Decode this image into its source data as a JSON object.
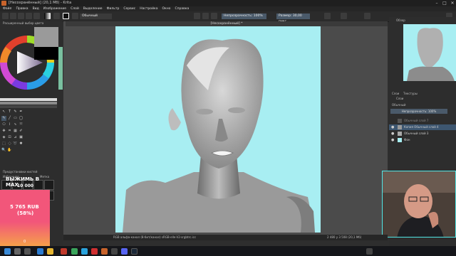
{
  "window": {
    "title": "[Несохранённый]  (20,1 Мб)  - Krita",
    "minimize": "–",
    "maximize": "□",
    "close": "✕"
  },
  "menu": [
    "Файл",
    "Правка",
    "Вид",
    "Изображение",
    "Слой",
    "Выделение",
    "Фильтр",
    "Сервис",
    "Настройка",
    "Окно",
    "Справка"
  ],
  "toolbar": {
    "blend_mode": "Обычный",
    "opacity": "Непрозрачность: 100%",
    "size": "Размер: 30,00 пикс."
  },
  "left_panel": {
    "color_title": "Расширенный выбор цвета",
    "brushes_title": "Предустановки кистей",
    "tags_label": "Избранное",
    "tag_label": "Метка"
  },
  "stream_overlay": {
    "title_line": "ВЫЖИМЬ В МАХ",
    "goal": "10 000",
    "amount": "5 765 RUB",
    "percent": "(58%)",
    "counter": "0"
  },
  "canvas": {
    "tab_title": "[Несохранённый] *"
  },
  "right_panel": {
    "overview_title": "Обзор",
    "tabs": [
      "Слои",
      "Текстуры"
    ],
    "layers_title": "Слои",
    "blend_mode": "Обычный",
    "opacity": "Непрозрачность: 100%",
    "layers": [
      {
        "name": "Обычный слой 7",
        "active": false
      },
      {
        "name": "Копия Обычный слой 4",
        "active": true
      },
      {
        "name": "Обычный слой 3",
        "active": false
      },
      {
        "name": "Фон",
        "active": false
      }
    ]
  },
  "status": {
    "color_model": "RGB альфа-канал (8-бит/канал)  sRGB-elle-V2-srgbtrc.icc",
    "dimensions": "2 480 у 3 508 (20,1 Мб)"
  },
  "colors": {
    "bg": "#2e2e2e",
    "canvas_bg": "#a8eef2",
    "accent": "#4a5a6a",
    "overlay": "#f2567a"
  }
}
